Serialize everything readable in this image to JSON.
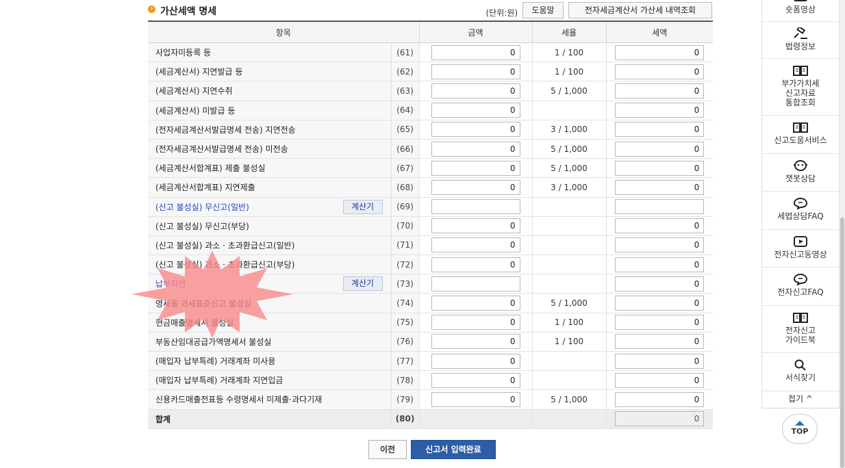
{
  "section": {
    "title": "가산세액 명세",
    "unit": "(단위:원)",
    "help_label": "도움말",
    "einvoice_label": "전자세금계산서 가산세 내역조회"
  },
  "table": {
    "headers": [
      "항목",
      "금액",
      "세율",
      "세액"
    ],
    "rows": [
      {
        "label": "사업자미등록 등",
        "code": "(61)",
        "amount": "0",
        "rate": "1 / 100",
        "tax": "0"
      },
      {
        "label": "(세금계산서) 지연발급 등",
        "code": "(62)",
        "amount": "0",
        "rate": "1 / 100",
        "tax": "0"
      },
      {
        "label": "(세금계산서) 지연수취",
        "code": "(63)",
        "amount": "0",
        "rate": "5 / 1,000",
        "tax": "0"
      },
      {
        "label": "(세금계산서) 미발급 등",
        "code": "(64)",
        "amount": "0",
        "rate": "",
        "tax": "0"
      },
      {
        "label": "(전자세금계산서발급명세 전송) 지연전송",
        "code": "(65)",
        "amount": "0",
        "rate": "3 / 1,000",
        "tax": "0"
      },
      {
        "label": "(전자세금계산서발급명세 전송) 미전송",
        "code": "(66)",
        "amount": "0",
        "rate": "5 / 1,000",
        "tax": "0"
      },
      {
        "label": "(세금계산서합계표) 제출 불성실",
        "code": "(67)",
        "amount": "0",
        "rate": "5 / 1,000",
        "tax": "0"
      },
      {
        "label": "(세금계산서합계표) 지연제출",
        "code": "(68)",
        "amount": "0",
        "rate": "3 / 1,000",
        "tax": "0"
      },
      {
        "label": "(신고 불성실) 무신고(일반)",
        "code": "(69)",
        "amount": "",
        "rate": "",
        "tax": "",
        "calc": "계산기"
      },
      {
        "label": "(신고 불성실) 무신고(부당)",
        "code": "(70)",
        "amount": "0",
        "rate": "",
        "tax": "0"
      },
      {
        "label": "(신고 불성실) 과소 · 초과환급신고(일반)",
        "code": "(71)",
        "amount": "0",
        "rate": "",
        "tax": "0"
      },
      {
        "label": "(신고 불성실) 과소 · 초과환급신고(부당)",
        "code": "(72)",
        "amount": "0",
        "rate": "",
        "tax": "0"
      },
      {
        "label": "납부지연",
        "code": "(73)",
        "amount": "",
        "rate": "",
        "tax": "0",
        "calc": "계산기"
      },
      {
        "label": "영세율 과세표준신고 불성실",
        "code": "(74)",
        "amount": "0",
        "rate": "5 / 1,000",
        "tax": "0"
      },
      {
        "label": "현금매출명세서 불성실",
        "code": "(75)",
        "amount": "0",
        "rate": "1 / 100",
        "tax": "0"
      },
      {
        "label": "부동산임대공급가액명세서 불성실",
        "code": "(76)",
        "amount": "0",
        "rate": "1 / 100",
        "tax": "0"
      },
      {
        "label": "(매입자 납부특례) 거래계좌 미사용",
        "code": "(77)",
        "amount": "0",
        "rate": "",
        "tax": "0"
      },
      {
        "label": "(매입자 납부특례) 거래계좌 지연입금",
        "code": "(78)",
        "amount": "0",
        "rate": "",
        "tax": "0"
      },
      {
        "label": "신용카드매출전표등 수령명세서 미제출·과다기재",
        "code": "(79)",
        "amount": "0",
        "rate": "5 / 1,000",
        "tax": "0"
      }
    ],
    "total": {
      "label": "합계",
      "code": "(80)",
      "tax": "0"
    }
  },
  "buttons": {
    "prev": "이전",
    "complete": "신고서 입력완료"
  },
  "quick_menu": {
    "items": [
      {
        "label": "숏폼영상",
        "icon": "video-icon"
      },
      {
        "label": "법령정보",
        "icon": "gavel-icon"
      },
      {
        "label": "부가가치세\n신고자료\n통합조회",
        "icon": "book-icon"
      },
      {
        "label": "신고도움서비스",
        "icon": "book-icon"
      },
      {
        "label": "챗봇상담",
        "icon": "chatbot-icon"
      },
      {
        "label": "세법상담FAQ",
        "icon": "chat-bubble-icon"
      },
      {
        "label": "전자신고동영상",
        "icon": "play-icon"
      },
      {
        "label": "전자신고FAQ",
        "icon": "chat-bubble-icon"
      },
      {
        "label": "전자신고\n가이드북",
        "icon": "book-icon"
      },
      {
        "label": "서식찾기",
        "icon": "search-icon"
      }
    ],
    "fold": "접기 ^",
    "top": "TOP"
  },
  "colors": {
    "accent": "#2d5da8",
    "highlight": "#f88a8a",
    "link": "#1f3fc2"
  }
}
